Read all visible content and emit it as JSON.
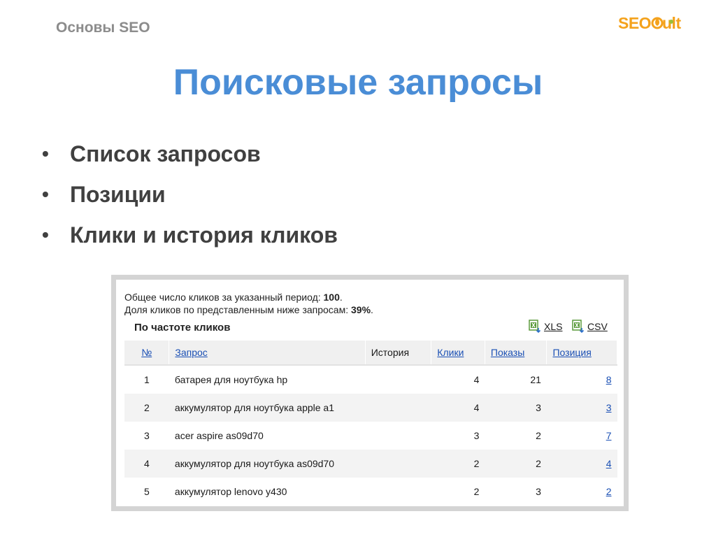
{
  "header": {
    "course": "Основы SEO",
    "logo_text": "SEOPult"
  },
  "title": "Поисковые запросы",
  "bullets": [
    "Список запросов",
    "Позиции",
    "Клики и история кликов"
  ],
  "screenshot": {
    "summary_line1_prefix": "Общее число кликов за указанный период: ",
    "summary_line1_value": "100",
    "summary_line1_suffix": ".",
    "summary_line2_prefix": "Доля кликов по представленным ниже запросам: ",
    "summary_line2_value": "39%",
    "summary_line2_suffix": ".",
    "sort_label": "По частоте кликов",
    "export": {
      "xls": "XLS",
      "csv": "CSV"
    },
    "columns": {
      "num": "№",
      "query": "Запрос",
      "history": "История",
      "clicks": "Клики",
      "shows": "Показы",
      "position": "Позиция"
    },
    "rows": [
      {
        "num": "1",
        "query": "батарея для ноутбука hp",
        "history": "",
        "clicks": "4",
        "shows": "21",
        "position": "8"
      },
      {
        "num": "2",
        "query": "аккумулятор для ноутбука apple a1",
        "history": "",
        "clicks": "4",
        "shows": "3",
        "position": "3"
      },
      {
        "num": "3",
        "query": "acer aspire as09d70",
        "history": "",
        "clicks": "3",
        "shows": "2",
        "position": "7"
      },
      {
        "num": "4",
        "query": "аккумулятор для ноутбука as09d70",
        "history": "",
        "clicks": "2",
        "shows": "2",
        "position": "4"
      },
      {
        "num": "5",
        "query": "аккумулятор lenovo y430",
        "history": "",
        "clicks": "2",
        "shows": "3",
        "position": "2"
      }
    ]
  },
  "colors": {
    "title": "#4a8dd6",
    "logo": "#f4a21c",
    "link": "#1a4fb4"
  }
}
